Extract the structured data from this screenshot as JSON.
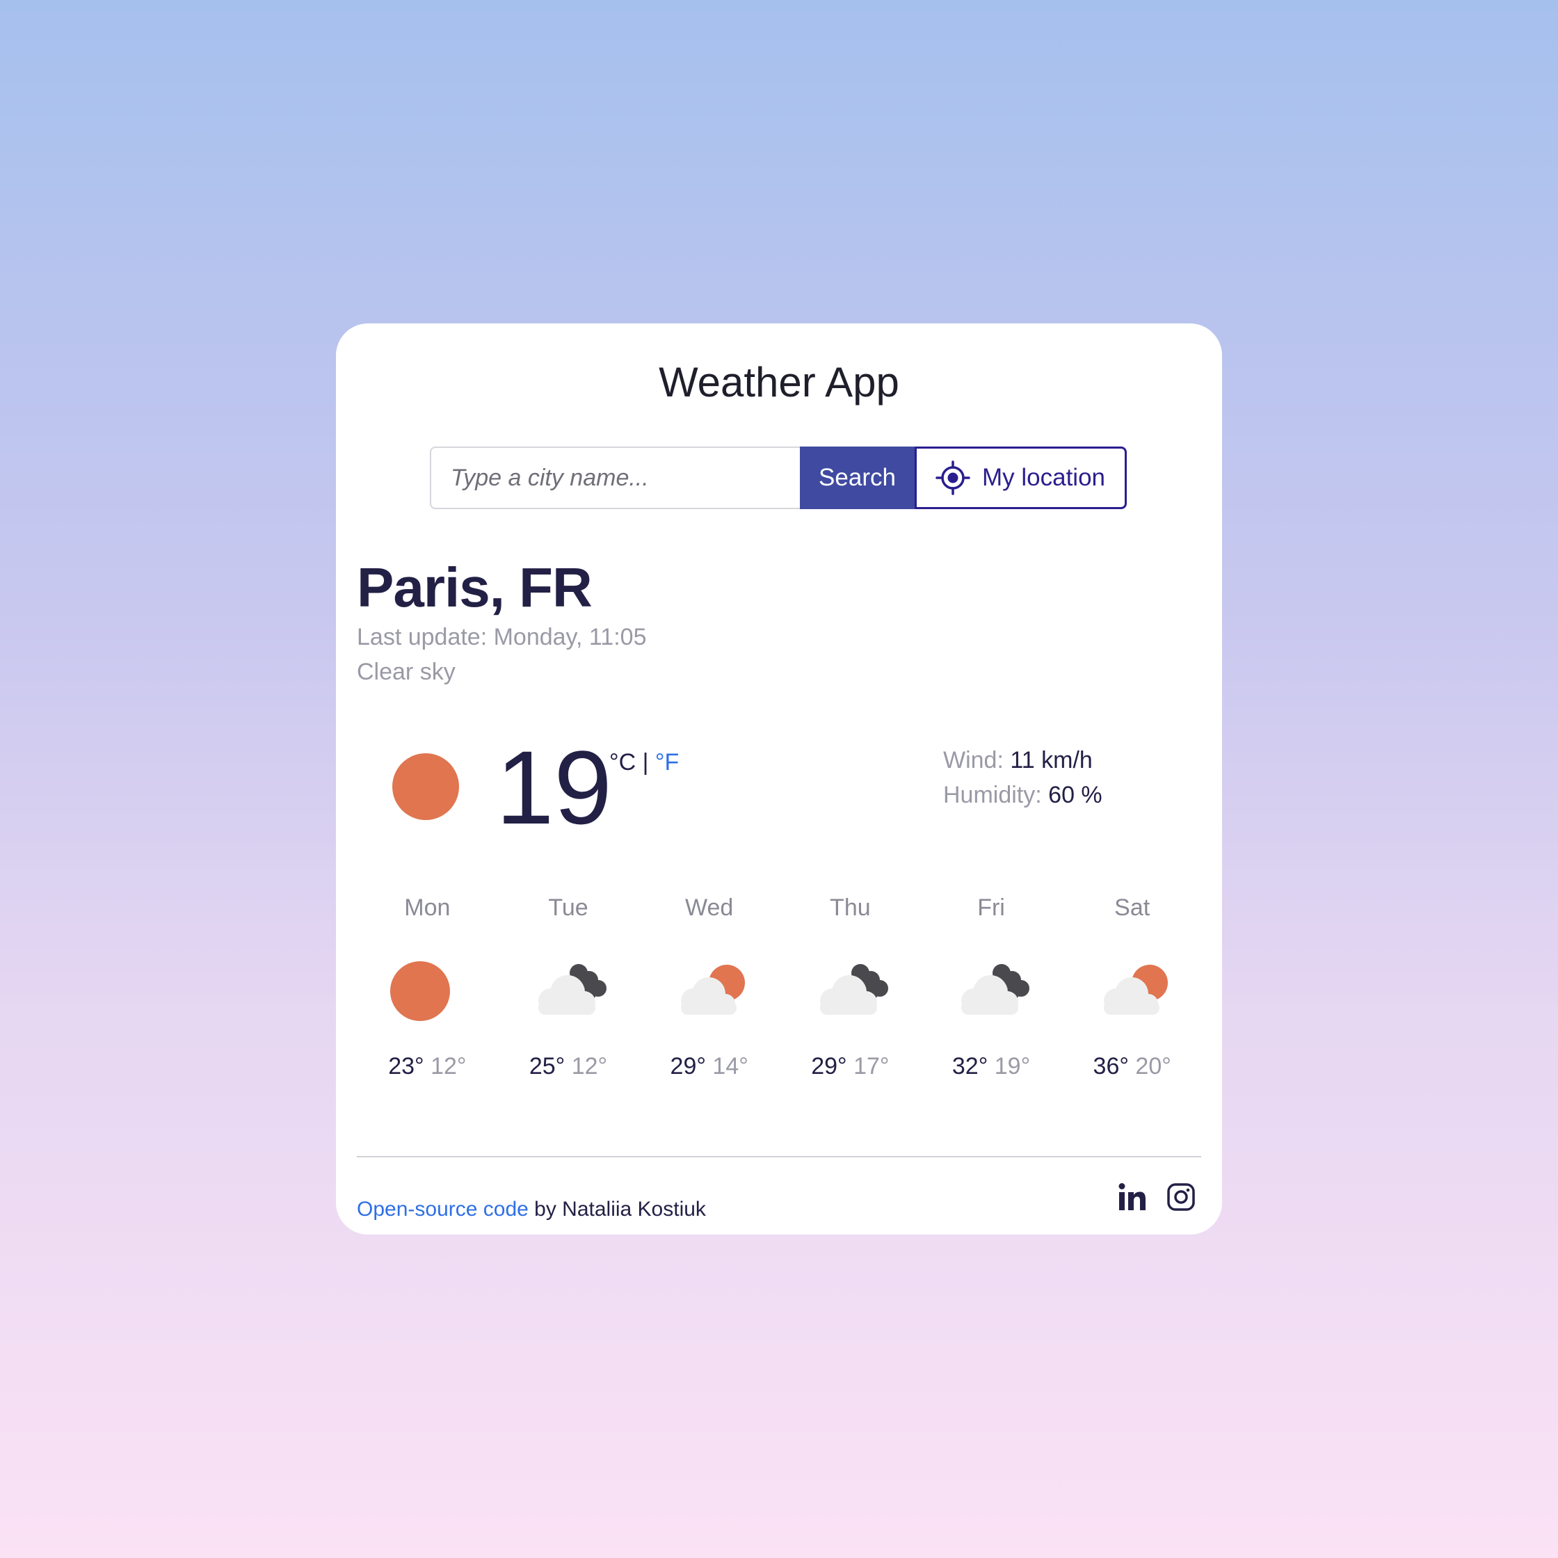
{
  "app": {
    "title": "Weather App"
  },
  "search": {
    "placeholder": "Type a city name...",
    "value": "",
    "search_label": "Search",
    "location_label": "My location"
  },
  "current": {
    "city": "Paris, FR",
    "last_update": "Last update: Monday, 11:05",
    "description": "Clear sky",
    "icon": "sun-icon",
    "temperature": "19",
    "unit_celsius": "°C",
    "unit_separator": "|",
    "unit_fahrenheit": "°F",
    "wind_label": "Wind:",
    "wind_value": "11 km/h",
    "humidity_label": "Humidity:",
    "humidity_value": "60 %"
  },
  "forecast": [
    {
      "day": "Mon",
      "icon": "sun-icon",
      "max": "23°",
      "min": "12°"
    },
    {
      "day": "Tue",
      "icon": "dark-clouds-icon",
      "max": "25°",
      "min": "12°"
    },
    {
      "day": "Wed",
      "icon": "partly-cloudy-icon",
      "max": "29°",
      "min": "14°"
    },
    {
      "day": "Thu",
      "icon": "dark-clouds-icon",
      "max": "29°",
      "min": "17°"
    },
    {
      "day": "Fri",
      "icon": "dark-clouds-icon",
      "max": "32°",
      "min": "19°"
    },
    {
      "day": "Sat",
      "icon": "partly-cloudy-icon",
      "max": "36°",
      "min": "20°"
    }
  ],
  "footer": {
    "link_text": "Open-source code",
    "by_text": " by Nataliia Kostiuk",
    "social": [
      "linkedin-icon",
      "instagram-icon"
    ]
  },
  "colors": {
    "accent": "#3f4aa0",
    "location_border": "#2a1e8e",
    "sun": "#e07550",
    "link": "#2f6fe6",
    "text_dark": "#232046",
    "text_muted": "#9a9aa6"
  }
}
